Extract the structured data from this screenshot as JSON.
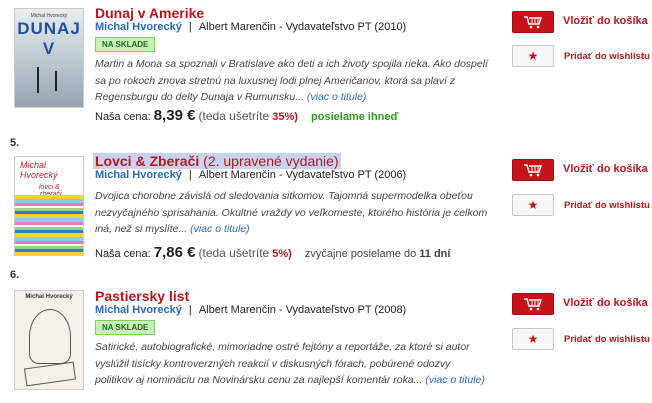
{
  "items": [
    {
      "number": "",
      "cover": {
        "title_text": "DUNAJ V",
        "author_text": "Michal Hvorecký"
      },
      "title": "Dunaj v Amerike",
      "title_edition": "",
      "author": "Michal Hvorecký",
      "publisher_line": "Albert Marenčin - Vydavateľstvo PT (2010)",
      "badge": "NA SKLADE",
      "description": "Martin a Mona sa spoznali v Bratislave ako deti a ich životy spojila rieka. Ako dospelí sa po rokoch znova stretnú na luxusnej lodi plnej Američanov, ktorá sa plaví z Regensburgu do delty Dunaja v Rumunsku...",
      "more_link": "(viac o titule)",
      "price_label": "Naša cena:",
      "price": "8,39 €",
      "saving_text_before": "(teda ušetríte",
      "saving_pct": "35%)",
      "shipping": "posielame ihneď",
      "shipping_style": "green",
      "cart_label": "Vložiť do košíka",
      "wishlist_label": "Pridať do wishlistu"
    },
    {
      "number": "5.",
      "cover": {
        "title_text": "lovci & zberači",
        "author_text": "Michal Hvorecký"
      },
      "title": "Lovci & Zberači",
      "title_edition": "(2. upravené vydanie)",
      "author": "Michal Hvorecký",
      "publisher_line": "Albert Marenčin - Vydavateľstvo PT (2006)",
      "badge": "",
      "description": "Dvojica chorobne závislá od sledovania sitkomov. Tajomná supermodelka obeťou nezvyčajného sprisahania. Okultné vraždy vo veľkomeste, ktorého história je celkom iná, než si myslíte...",
      "more_link": "(viac o titule)",
      "price_label": "Naša cena:",
      "price": "7,86 €",
      "saving_text_before": "(teda ušetríte",
      "saving_pct": "5%)",
      "shipping": "zvyčajne posielame do",
      "shipping_days": "11 dní",
      "shipping_style": "normal",
      "cart_label": "Vložiť do košíka",
      "wishlist_label": "Pridať do wishlistu"
    },
    {
      "number": "6.",
      "cover": {
        "title_text": "Michal Hvorecký",
        "author_text": ""
      },
      "title": "Pastiersky list",
      "title_edition": "",
      "author": "Michal Hvorecký",
      "publisher_line": "Albert Marenčin - Vydavateľstvo PT (2008)",
      "badge": "NA SKLADE",
      "description": "Satirické, autobiografické, mimoriadne ostré fejtóny a reportáže, za ktoré si autor vyslúžil tisícky kontroverzných reakcií v diskusných fórach, pobúrené odozvy politikov aj nomináciu na Novinársku cenu za najlepší komentár roka...",
      "more_link": "(viac o titule)",
      "cart_label": "Vložiť do košíka",
      "wishlist_label": "Pridať do wishlistu"
    }
  ],
  "icons": {
    "cart": "cart-icon",
    "star": "star-icon"
  },
  "colors": {
    "brand_red": "#b8171d",
    "button_red": "#c8121a",
    "link_blue": "#2a6ab0",
    "stock_green": "#c9f0b9"
  }
}
